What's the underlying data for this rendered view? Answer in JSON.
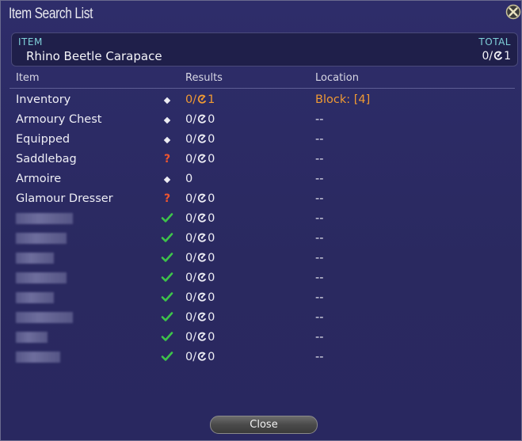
{
  "window": {
    "title": "Item Search List"
  },
  "summary": {
    "item_label": "ITEM",
    "total_label": "TOTAL",
    "item_name": "Rhino Beetle Carapace",
    "total_value": "0/",
    "total_hq": "1"
  },
  "headers": {
    "item": "Item",
    "results": "Results",
    "location": "Location"
  },
  "rows": [
    {
      "name": "Inventory",
      "status": "diamond",
      "result": "0/",
      "result_hq": "1",
      "location": "Block:  [4]",
      "highlight": true
    },
    {
      "name": "Armoury Chest",
      "status": "diamond",
      "result": "0/",
      "result_hq": "0",
      "location": "--"
    },
    {
      "name": "Equipped",
      "status": "diamond",
      "result": "0/",
      "result_hq": "0",
      "location": "--"
    },
    {
      "name": "Saddlebag",
      "status": "question",
      "result": "0/",
      "result_hq": "0",
      "location": "--"
    },
    {
      "name": "Armoire",
      "status": "diamond",
      "result": "0",
      "result_hq": "",
      "location": "--"
    },
    {
      "name": "Glamour Dresser",
      "status": "question",
      "result": "0/",
      "result_hq": "0",
      "location": "--"
    },
    {
      "name": "",
      "status": "check",
      "result": "0/",
      "result_hq": "0",
      "location": "--",
      "redacted": 72
    },
    {
      "name": "",
      "status": "check",
      "result": "0/",
      "result_hq": "0",
      "location": "--",
      "redacted": 64
    },
    {
      "name": "",
      "status": "check",
      "result": "0/",
      "result_hq": "0",
      "location": "--",
      "redacted": 48
    },
    {
      "name": "",
      "status": "check",
      "result": "0/",
      "result_hq": "0",
      "location": "--",
      "redacted": 64
    },
    {
      "name": "",
      "status": "check",
      "result": "0/",
      "result_hq": "0",
      "location": "--",
      "redacted": 48
    },
    {
      "name": "",
      "status": "check",
      "result": "0/",
      "result_hq": "0",
      "location": "--",
      "redacted": 72
    },
    {
      "name": "",
      "status": "check",
      "result": "0/",
      "result_hq": "0",
      "location": "--",
      "redacted": 40
    },
    {
      "name": "",
      "status": "check",
      "result": "0/",
      "result_hq": "0",
      "location": "--",
      "redacted": 56
    }
  ],
  "footer": {
    "close_label": "Close"
  },
  "colors": {
    "highlight": "#f09a33",
    "check": "#3ec44a",
    "question": "#f0552e",
    "accent_label": "#7fd0d9"
  },
  "icons": {
    "close": "close-x-icon",
    "hq": "hq-crystal-icon"
  }
}
